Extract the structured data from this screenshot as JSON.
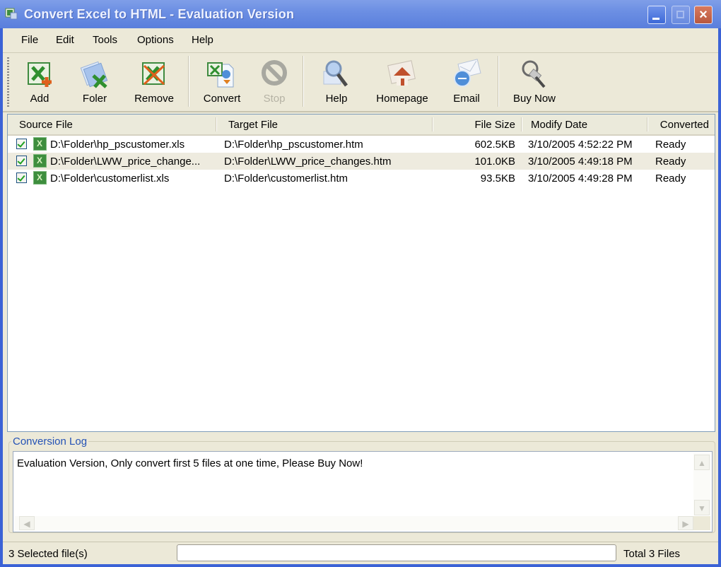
{
  "window": {
    "title": "Convert Excel to HTML  -  Evaluation Version",
    "controls": {
      "minimize": "minimize",
      "maximize": "maximize",
      "close": "×"
    }
  },
  "menu": [
    "File",
    "Edit",
    "Tools",
    "Options",
    "Help"
  ],
  "toolbar": {
    "add": "Add",
    "folder": "Foler",
    "remove": "Remove",
    "convert": "Convert",
    "stop": "Stop",
    "help": "Help",
    "homepage": "Homepage",
    "email": "Email",
    "buy_now": "Buy Now"
  },
  "file_list": {
    "columns": [
      "Source File",
      "Target File",
      "File Size",
      "Modify Date",
      "Converted"
    ],
    "rows": [
      {
        "checked": true,
        "source": "D:\\Folder\\hp_pscustomer.xls",
        "target": "D:\\Folder\\hp_pscustomer.htm",
        "size": "602.5KB",
        "date": "3/10/2005 4:52:22 PM",
        "status": "Ready"
      },
      {
        "checked": true,
        "source": "D:\\Folder\\LWW_price_change...",
        "target": "D:\\Folder\\LWW_price_changes.htm",
        "size": "101.0KB",
        "date": "3/10/2005 4:49:18 PM",
        "status": "Ready"
      },
      {
        "checked": true,
        "source": "D:\\Folder\\customerlist.xls",
        "target": "D:\\Folder\\customerlist.htm",
        "size": "93.5KB",
        "date": "3/10/2005 4:49:28 PM",
        "status": "Ready"
      }
    ]
  },
  "log": {
    "title": "Conversion Log",
    "text": "Evaluation Version, Only convert first 5 files at one time, Please Buy Now!"
  },
  "status": {
    "selected": "3 Selected file(s)",
    "progress": 0,
    "total": "Total 3 Files"
  },
  "colors": {
    "titlebar": "#6c8fe3",
    "window_bg": "#ece9d8",
    "log_title": "#2452b5",
    "alt_row": "#eeebdf"
  }
}
